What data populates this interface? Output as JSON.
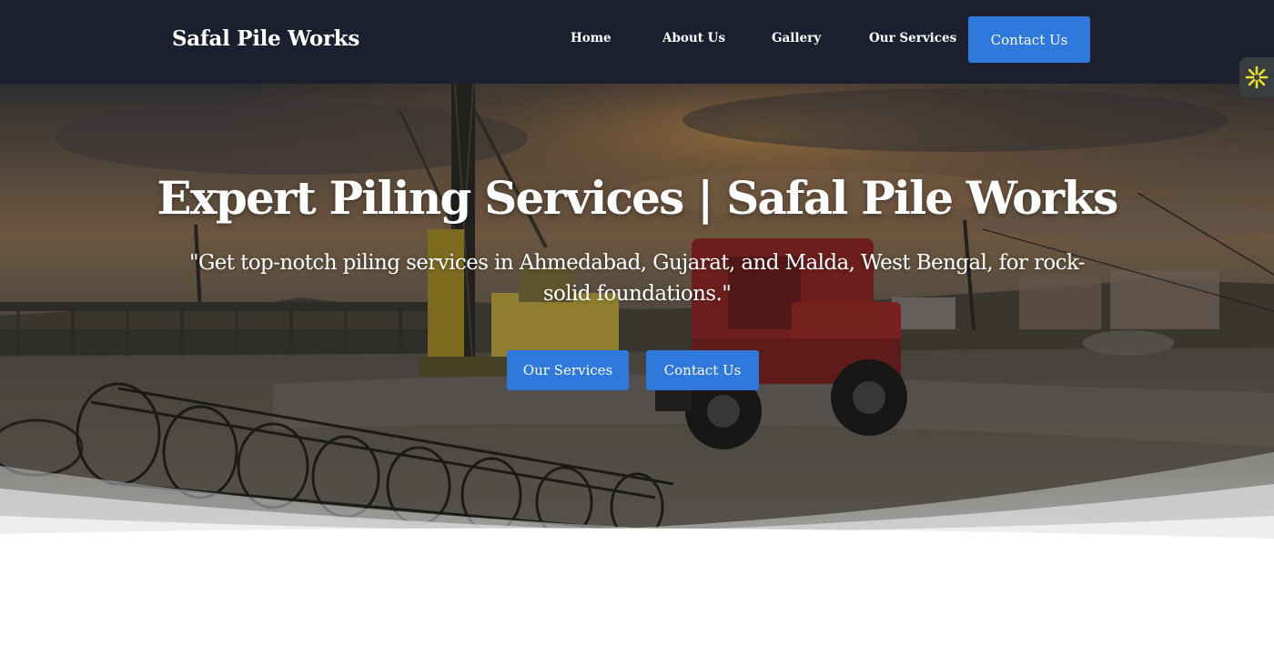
{
  "nav": {
    "brand": "Safal Pile Works",
    "links": [
      "Home",
      "About Us",
      "Gallery",
      "Our Services"
    ],
    "cta": "Contact Us"
  },
  "hero": {
    "title": "Expert Piling Services | Safal Pile Works",
    "subtitle": "\"Get top-notch piling services in Ahmedabad, Gujarat, and Malda, West Bengal, for rock-solid foundations.\"",
    "buttons": [
      "Our Services",
      "Contact Us"
    ]
  },
  "widget": {
    "icon": "accessibility-icon"
  },
  "colors": {
    "navbar": "#1b1f2e",
    "button": "#2f78dc",
    "widget_accent": "#e8e22a"
  }
}
